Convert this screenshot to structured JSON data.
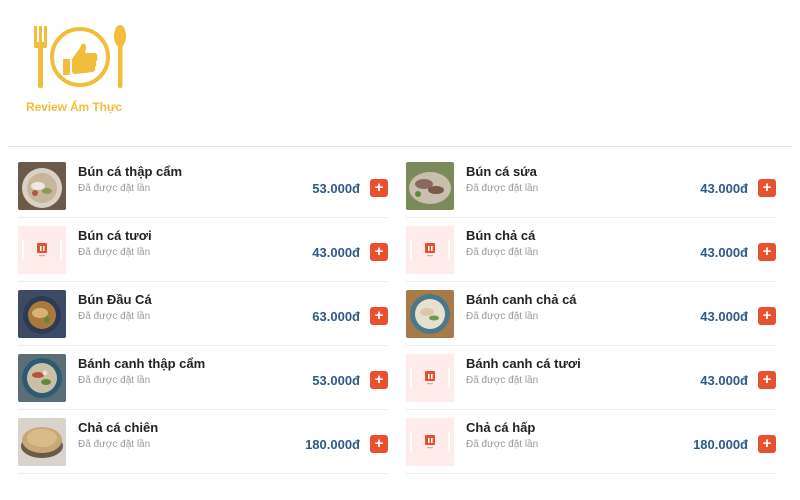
{
  "logo": {
    "text": "Review Ẩm Thực"
  },
  "menu": {
    "left": [
      {
        "name": "Bún cá thập cẩm",
        "ordered": "Đã được đặt lần",
        "price": "53.000đ",
        "thumb": "fish-soup-photo",
        "add_label": "+"
      },
      {
        "name": "Bún cá tươi",
        "ordered": "Đã được đặt lần",
        "price": "43.000đ",
        "thumb": "placeholder-store-icon",
        "add_label": "+"
      },
      {
        "name": "Bún Đầu Cá",
        "ordered": "Đã được đặt lần",
        "price": "63.000đ",
        "thumb": "fish-head-photo",
        "add_label": "+"
      },
      {
        "name": "Bánh canh thập cẩm",
        "ordered": "Đã được đặt lần",
        "price": "53.000đ",
        "thumb": "noodle-bowl-photo",
        "add_label": "+"
      },
      {
        "name": "Chả cá chiên",
        "ordered": "Đã được đặt lần",
        "price": "180.000đ",
        "thumb": "fried-fishcake-photo",
        "add_label": "+"
      }
    ],
    "right": [
      {
        "name": "Bún cá sứa",
        "ordered": "Đã được đặt lần",
        "price": "43.000đ",
        "thumb": "jellyfish-photo",
        "add_label": "+"
      },
      {
        "name": "Bún chả cá",
        "ordered": "Đã được đặt lần",
        "price": "43.000đ",
        "thumb": "placeholder-store-icon",
        "add_label": "+"
      },
      {
        "name": "Bánh canh chả cá",
        "ordered": "Đã được đặt lần",
        "price": "43.000đ",
        "thumb": "fishcake-soup-photo",
        "add_label": "+"
      },
      {
        "name": "Bánh canh cá tươi",
        "ordered": "Đã được đặt lần",
        "price": "43.000đ",
        "thumb": "placeholder-store-icon",
        "add_label": "+"
      },
      {
        "name": "Chả cá hấp",
        "ordered": "Đã được đặt lần",
        "price": "180.000đ",
        "thumb": "placeholder-store-icon",
        "add_label": "+"
      }
    ]
  },
  "colors": {
    "accent": "#e8512f",
    "price": "#2b5c8a",
    "brand": "#f2bd3a",
    "placeholder_bg": "#fdecea"
  }
}
